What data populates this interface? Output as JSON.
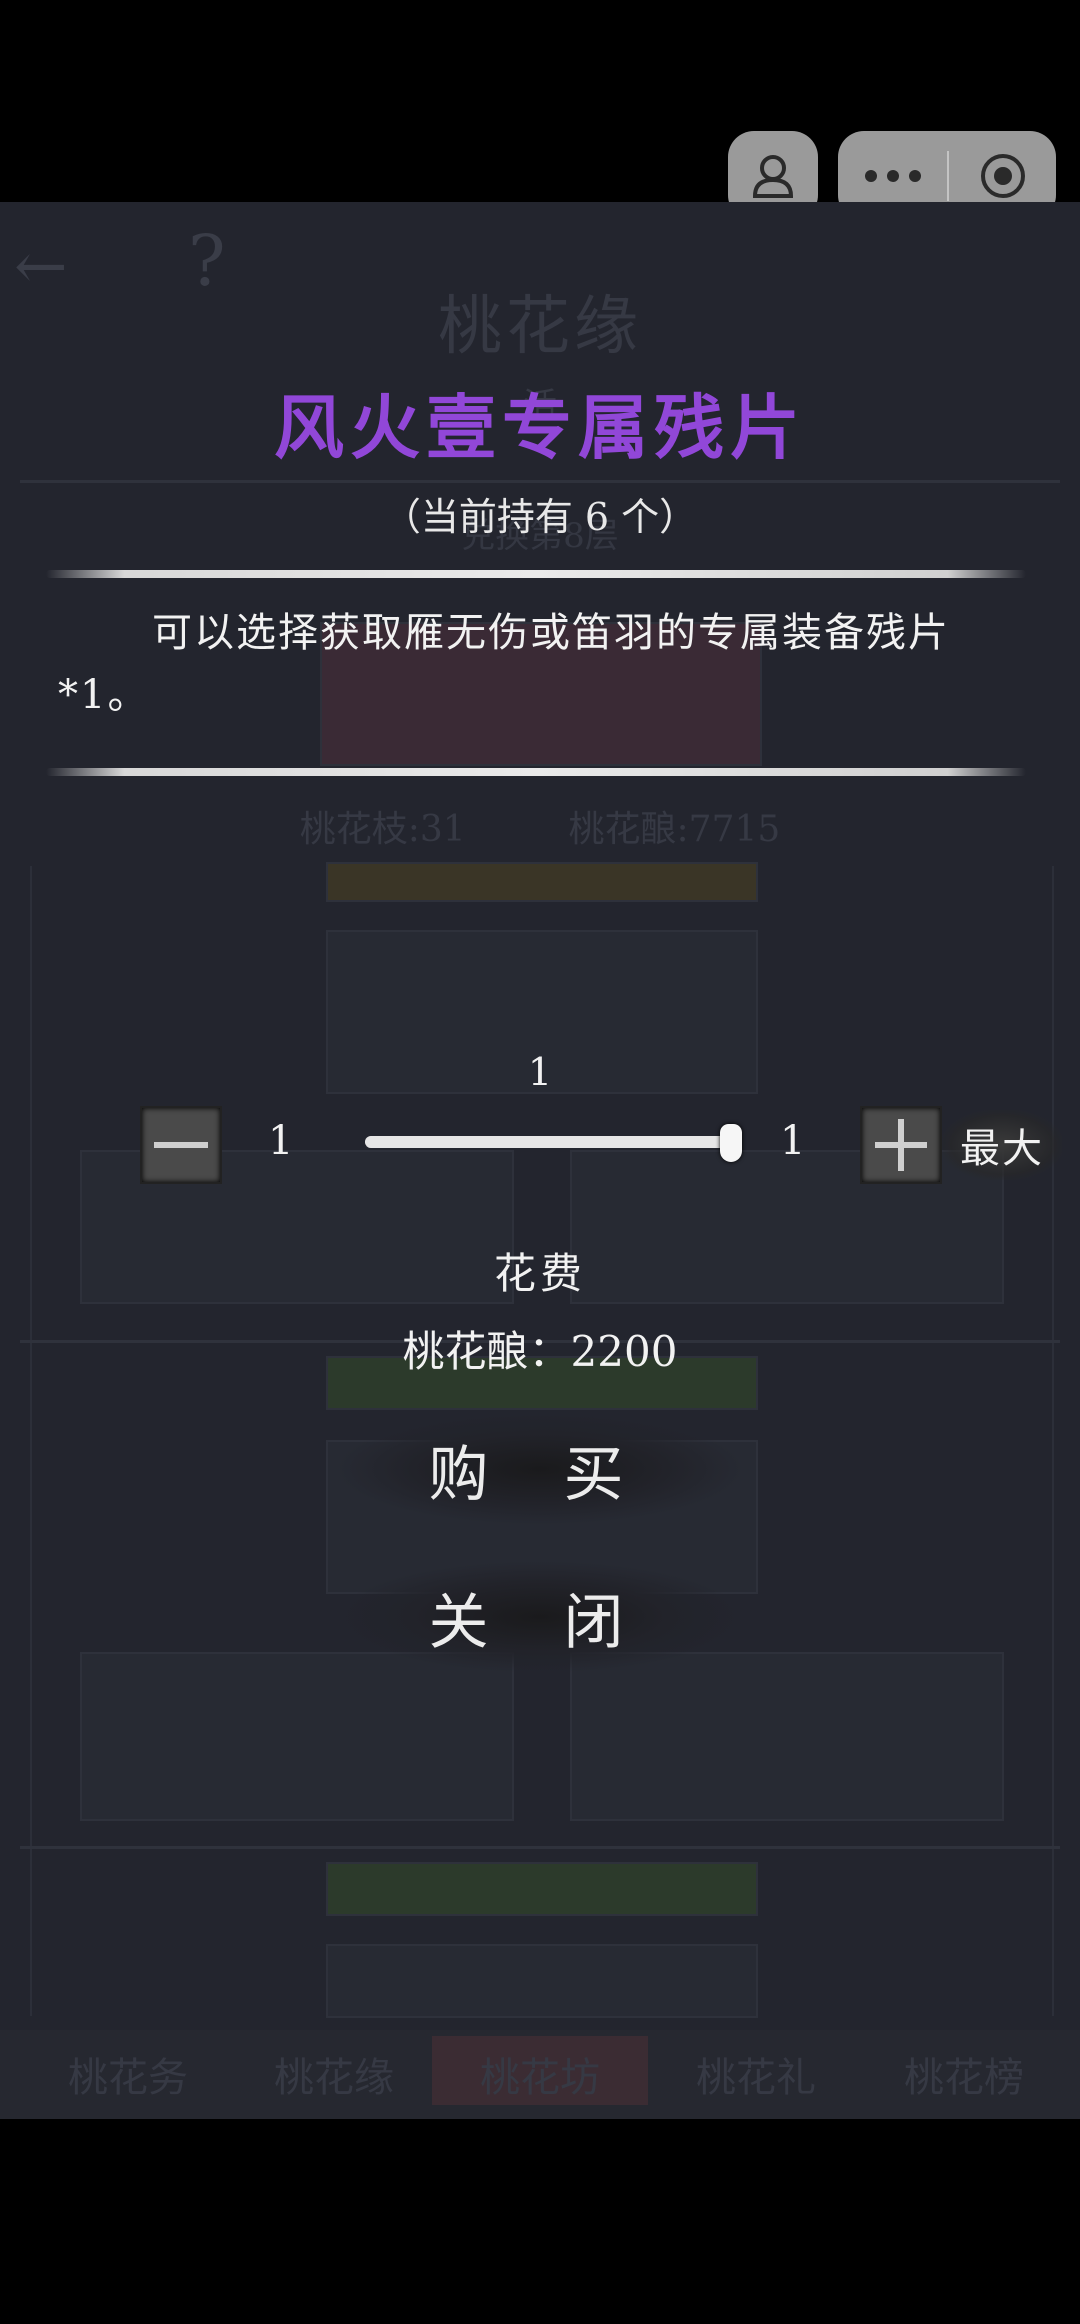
{
  "background": {
    "back_glyph": "←",
    "help_glyph": "?",
    "title": "桃花缘",
    "subtitle": "活",
    "exchange_hint": "兑换第8层",
    "currency": {
      "branch": "桃花枝:31",
      "wine": "桃花酿:7715"
    },
    "tabs": [
      "桃花务",
      "桃花缘",
      "桃花坊",
      "桃花礼",
      "桃花榜"
    ],
    "active_tab_index": 2
  },
  "dialog": {
    "title": "风火壹专属残片",
    "held": "（当前持有 6 个）",
    "description": "可以选择获取雁无伤或笛羽的专属装备残片*1。",
    "quantity": {
      "current": "1",
      "min": "1",
      "max": "1",
      "fill_fraction": 1.0,
      "max_button": "最大"
    },
    "cost_label": "花费",
    "cost_value": "桃花酿：2200",
    "buy_button": "购 买",
    "close_button": "关 闭"
  },
  "colors": {
    "title_purple": "#9147d8",
    "background": "#23252e"
  }
}
